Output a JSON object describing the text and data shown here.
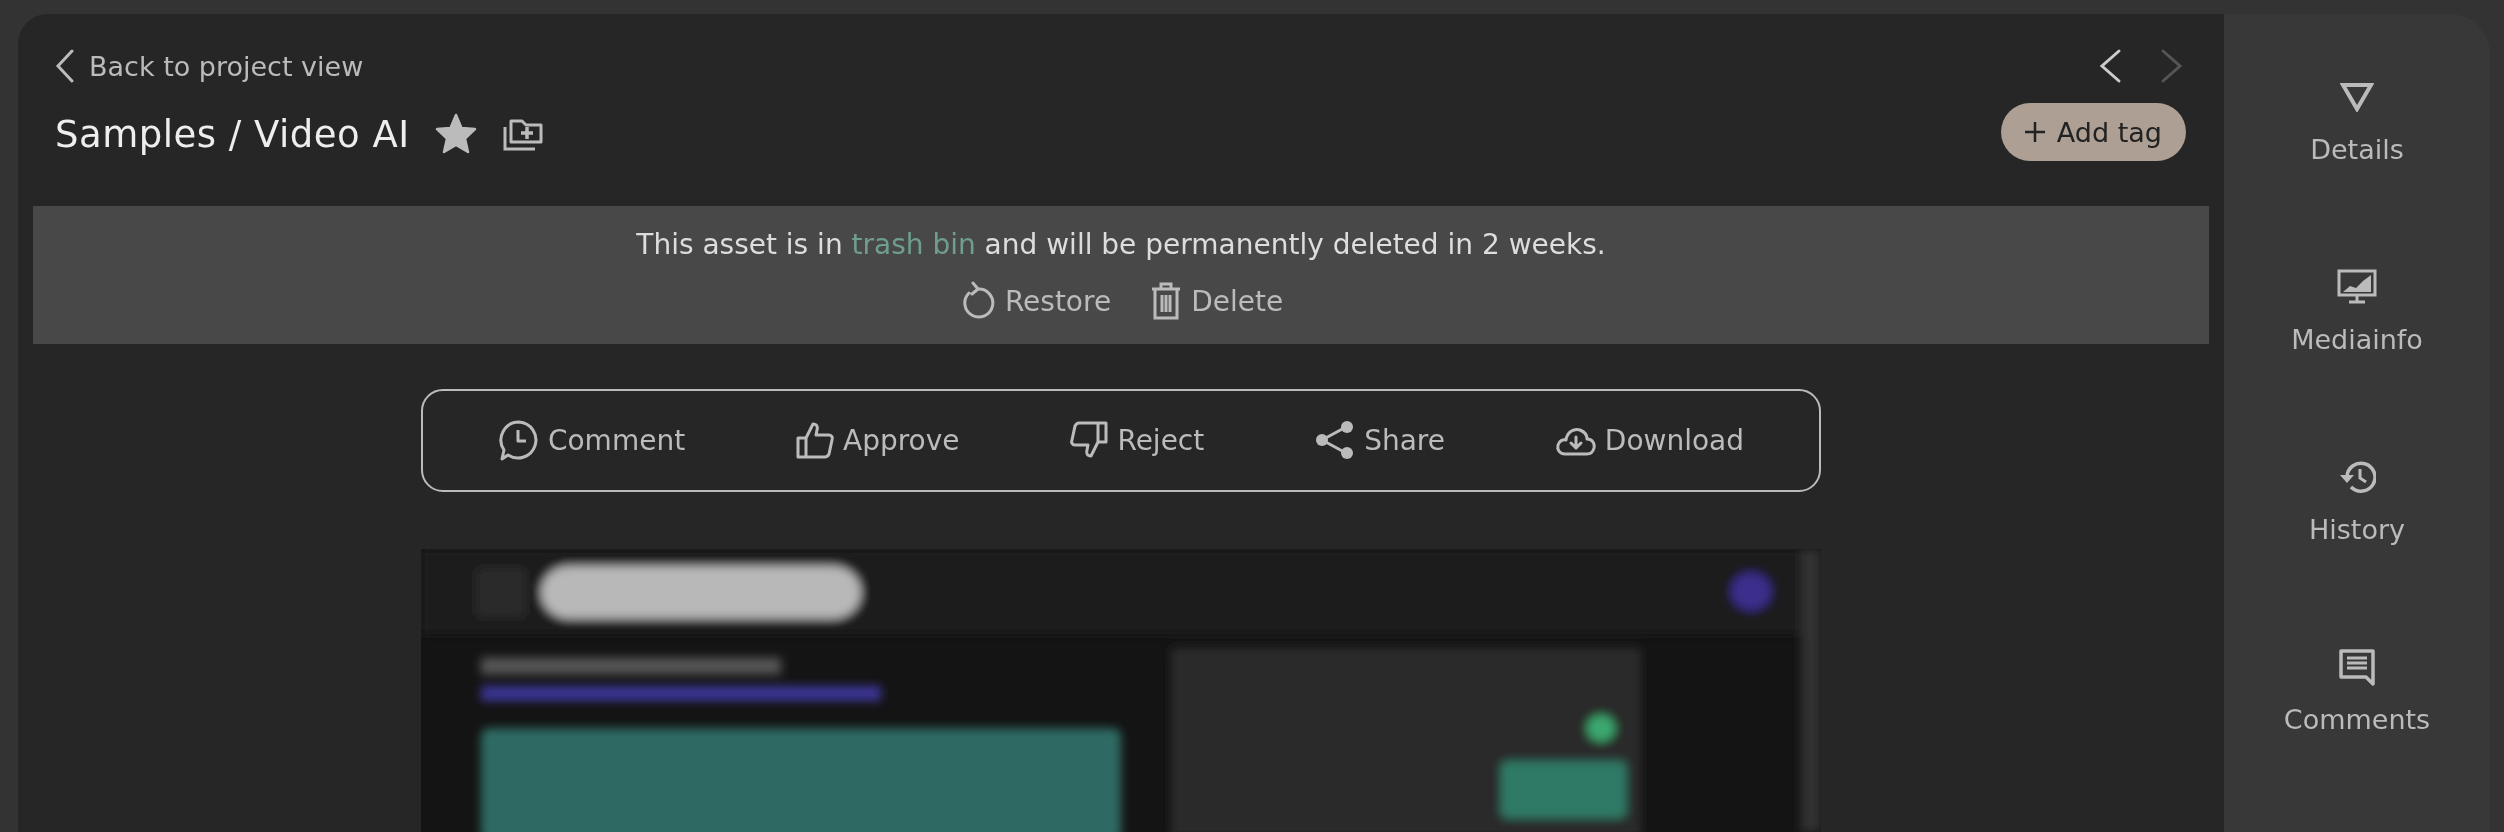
{
  "header": {
    "back_label": "Back to project view",
    "title": "Samples / Video AI",
    "starred": true,
    "prev_enabled": true,
    "next_enabled": false,
    "add_tag_label": "Add tag"
  },
  "banner": {
    "text_before": "This asset is in ",
    "link": "trash bin",
    "text_after": " and will be permanently deleted in 2 weeks.",
    "actions": [
      {
        "kind": "restore",
        "label": "Restore"
      },
      {
        "kind": "delete",
        "label": "Delete"
      }
    ]
  },
  "actions": [
    {
      "kind": "comment",
      "label": "Comment"
    },
    {
      "kind": "approve",
      "label": "Approve"
    },
    {
      "kind": "reject",
      "label": "Reject"
    },
    {
      "kind": "share",
      "label": "Share"
    },
    {
      "kind": "download",
      "label": "Download"
    }
  ],
  "sidebar": {
    "items": [
      {
        "kind": "details",
        "label": "Details"
      },
      {
        "kind": "mediainfo",
        "label": "Mediainfo"
      },
      {
        "kind": "history",
        "label": "History"
      },
      {
        "kind": "comments",
        "label": "Comments"
      }
    ]
  }
}
